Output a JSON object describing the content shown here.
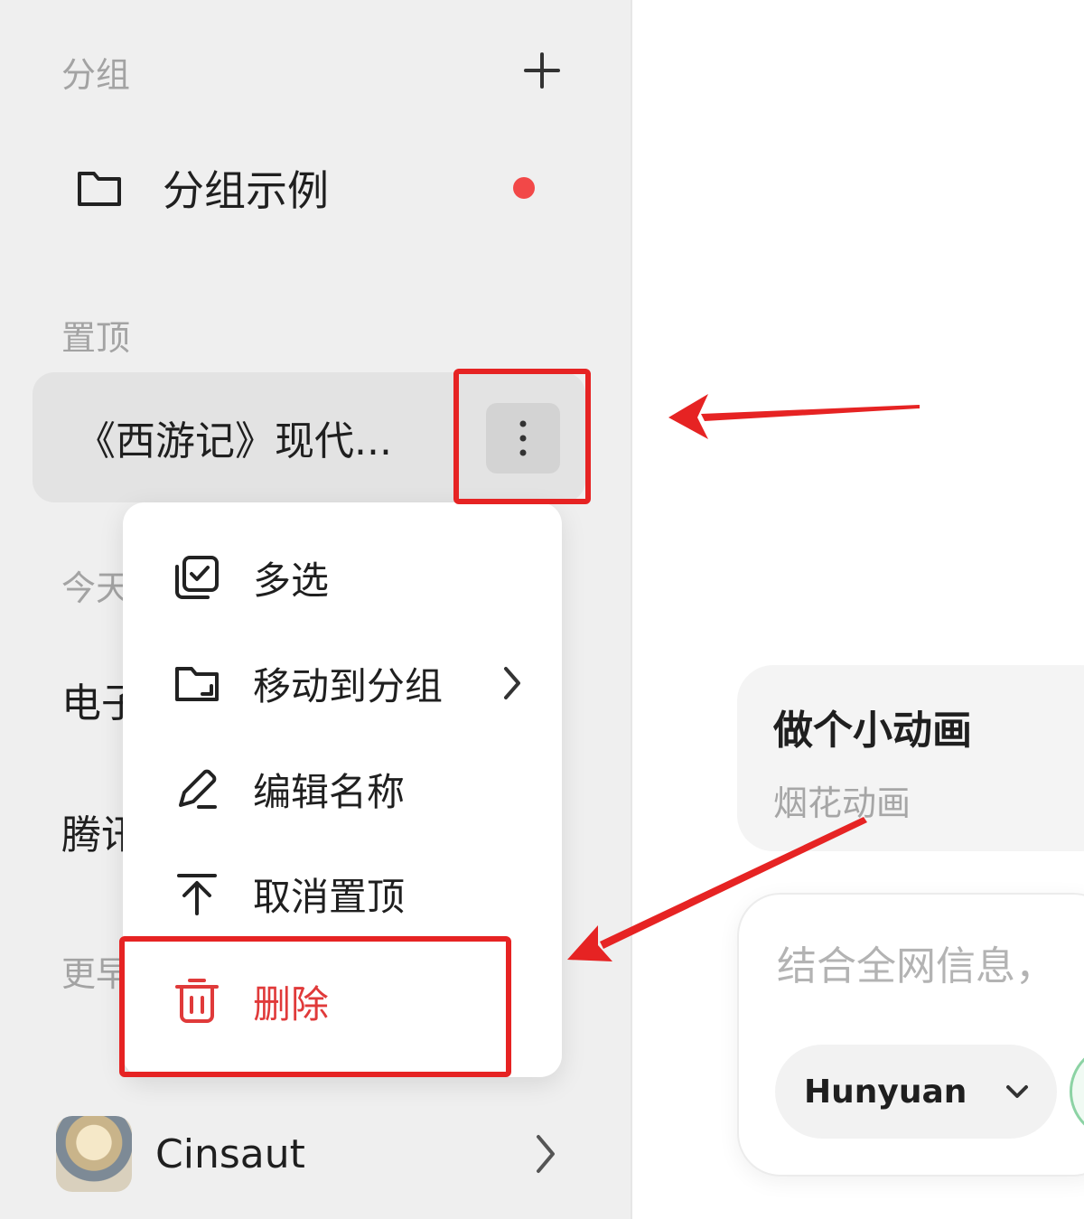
{
  "sidebar": {
    "groups_label": "分组",
    "group_item": {
      "name": "分组示例",
      "icon": "folder-icon"
    },
    "pinned_label": "置顶",
    "pinned_item": {
      "title": "《西游记》现代..."
    },
    "today_label": "今天",
    "history": [
      "电子",
      "腾讯"
    ],
    "earlier_label": "更早",
    "profile": {
      "name": "Cinsaut"
    }
  },
  "context_menu": {
    "items": [
      {
        "label": "多选",
        "icon": "multi-select-icon"
      },
      {
        "label": "移动到分组",
        "icon": "folder-move-icon"
      },
      {
        "label": "编辑名称",
        "icon": "pencil-icon"
      },
      {
        "label": "取消置顶",
        "icon": "unpin-icon"
      },
      {
        "label": "删除",
        "icon": "trash-icon"
      }
    ]
  },
  "main": {
    "suggestion": {
      "title": "做个小动画",
      "subtitle": "烟花动画"
    },
    "input": {
      "placeholder": "结合全网信息，"
    },
    "model": {
      "label": "Hunyuan"
    }
  },
  "colors": {
    "accent_red": "#e62323",
    "delete_red": "#e03a3a",
    "unread_dot": "#f24848",
    "sidebar_bg": "#efefef"
  }
}
